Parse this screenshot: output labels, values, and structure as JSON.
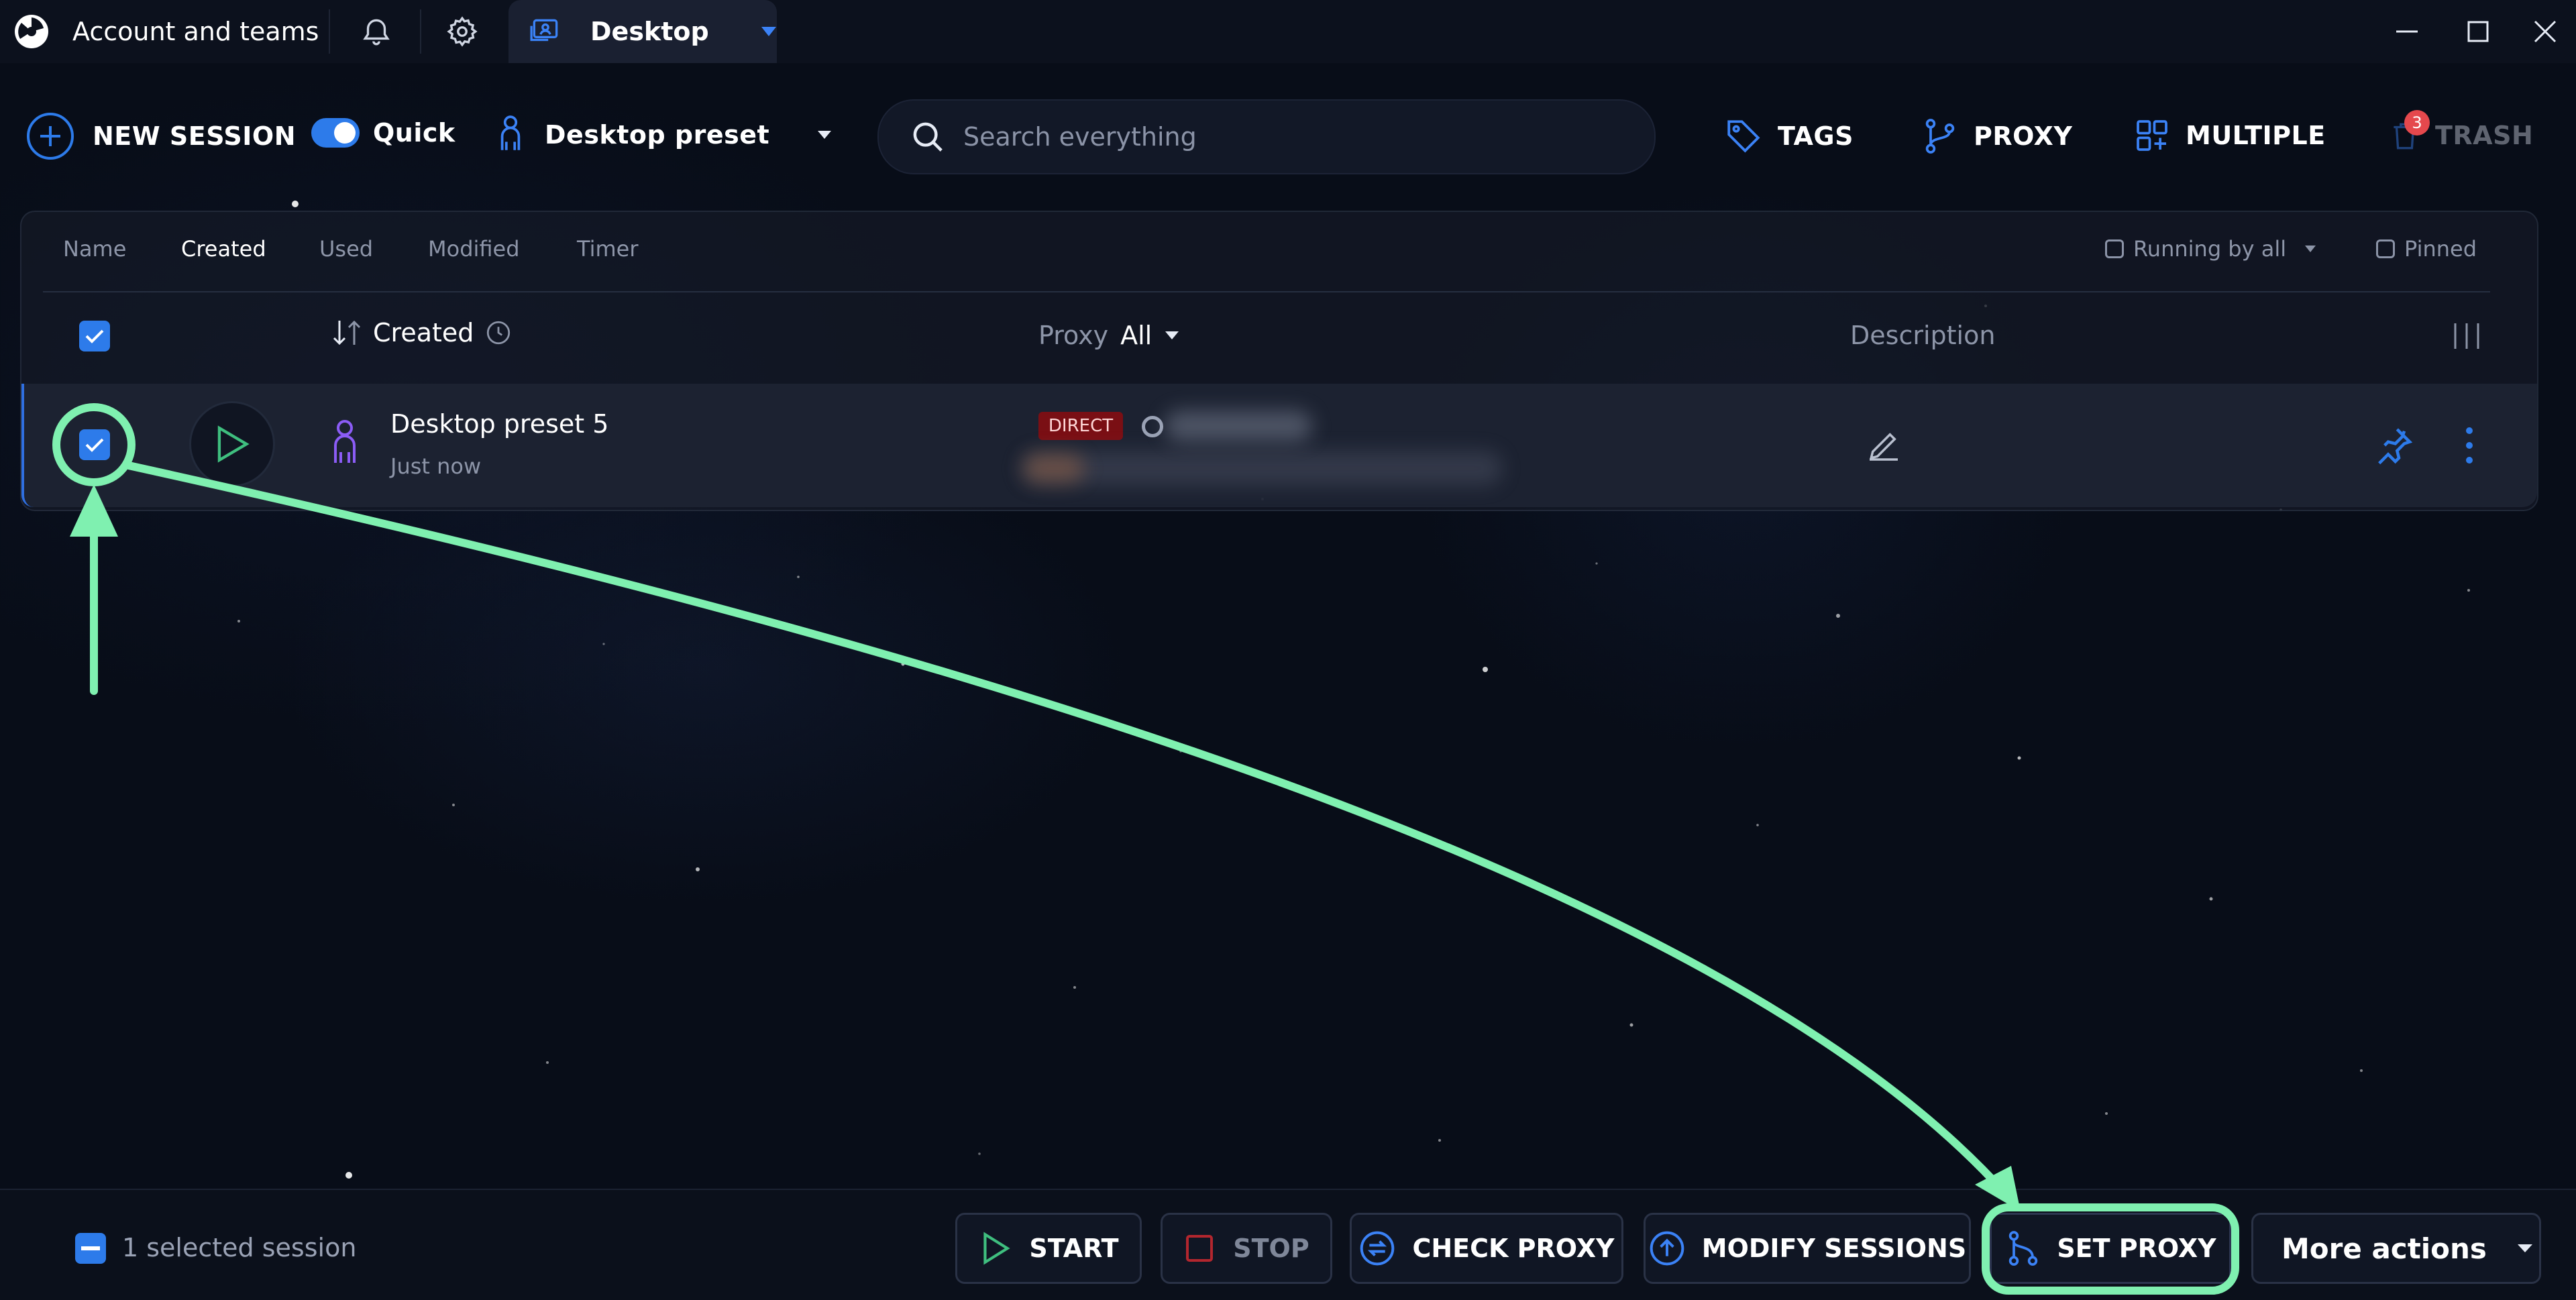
{
  "titlebar": {
    "app_title": "Account and teams",
    "tab_label": "Desktop"
  },
  "toolbar": {
    "new_session": "NEW SESSION",
    "quick_label": "Quick",
    "quick_enabled": true,
    "preset_label": "Desktop preset",
    "search_placeholder": "Search everything",
    "tags": "TAGS",
    "proxy": "PROXY",
    "multiple": "MULTIPLE",
    "trash": "TRASH",
    "trash_badge": "3"
  },
  "filters": {
    "sort_tabs": [
      "Name",
      "Created",
      "Used",
      "Modified",
      "Timer"
    ],
    "active_sort": "Created",
    "running_by_all": "Running by all",
    "pinned": "Pinned"
  },
  "table": {
    "header_created": "Created",
    "header_proxy": "Proxy",
    "header_proxy_filter": "All",
    "header_description": "Description",
    "rows": [
      {
        "name": "Desktop preset 5",
        "created": "Just now",
        "proxy_type": "DIRECT",
        "checked": true
      }
    ]
  },
  "bottom": {
    "selected_text": "1 selected session",
    "start": "START",
    "stop": "STOP",
    "check_proxy": "CHECK PROXY",
    "modify_sessions": "MODIFY SESSIONS",
    "set_proxy": "SET PROXY",
    "more_actions": "More actions"
  },
  "colors": {
    "accent_blue": "#2d7bea",
    "annotation_green": "#7ff0b0",
    "direct_badge": "#7a0f14",
    "trash_badge": "#e5484d"
  }
}
